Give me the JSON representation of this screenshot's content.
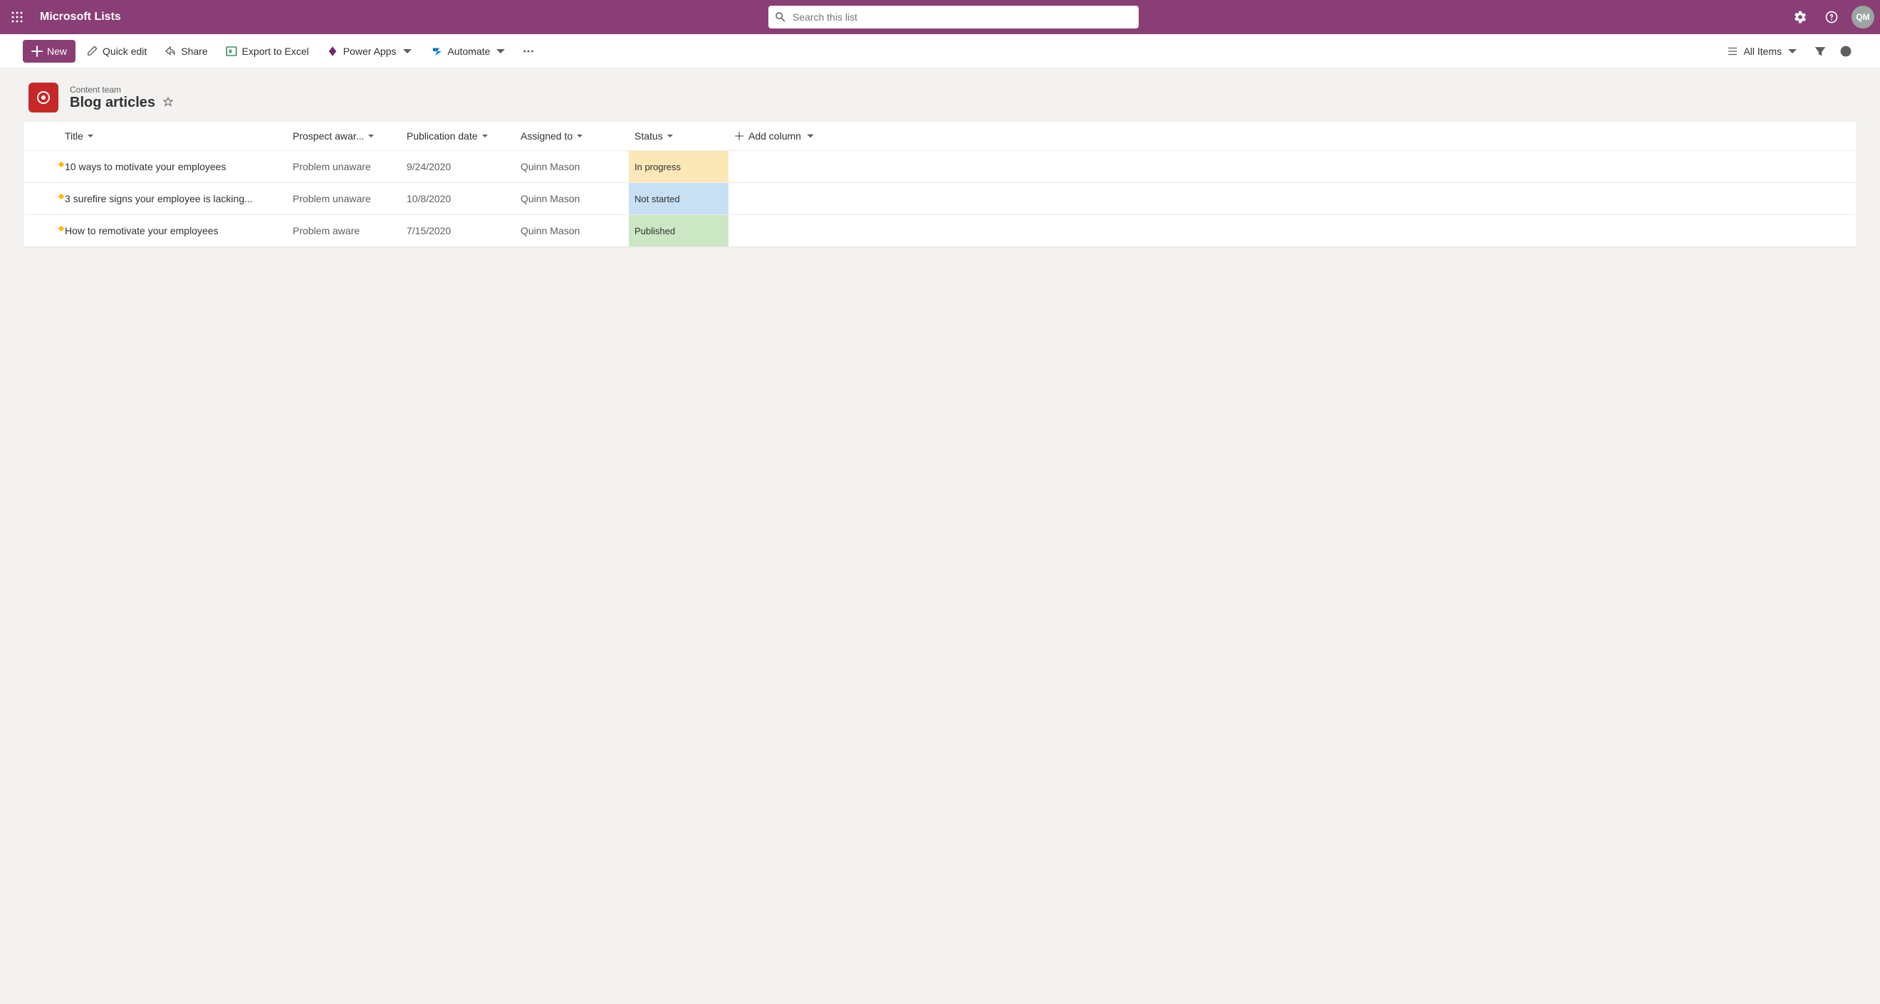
{
  "header": {
    "app_title": "Microsoft Lists",
    "search_placeholder": "Search this list",
    "avatar_initials": "QM"
  },
  "commands": {
    "new_label": "New",
    "quick_edit_label": "Quick edit",
    "share_label": "Share",
    "export_label": "Export to Excel",
    "power_apps_label": "Power Apps",
    "automate_label": "Automate",
    "view_label": "All Items"
  },
  "list": {
    "site_name": "Content team",
    "list_name": "Blog articles"
  },
  "columns": {
    "title": "Title",
    "prospect": "Prospect awar...",
    "publication": "Publication date",
    "assigned": "Assigned to",
    "status": "Status",
    "add_column": "Add column"
  },
  "rows": [
    {
      "title": "10 ways to motivate your employees",
      "prospect": "Problem unaware",
      "publication": "9/24/2020",
      "assigned": "Quinn Mason",
      "status": "In progress",
      "status_class": "status-inprogress"
    },
    {
      "title": "3 surefire signs your employee is lacking...",
      "prospect": "Problem unaware",
      "publication": "10/8/2020",
      "assigned": "Quinn Mason",
      "status": "Not started",
      "status_class": "status-notstarted"
    },
    {
      "title": "How to remotivate your employees",
      "prospect": "Problem aware",
      "publication": "7/15/2020",
      "assigned": "Quinn Mason",
      "status": "Published",
      "status_class": "status-published"
    }
  ]
}
